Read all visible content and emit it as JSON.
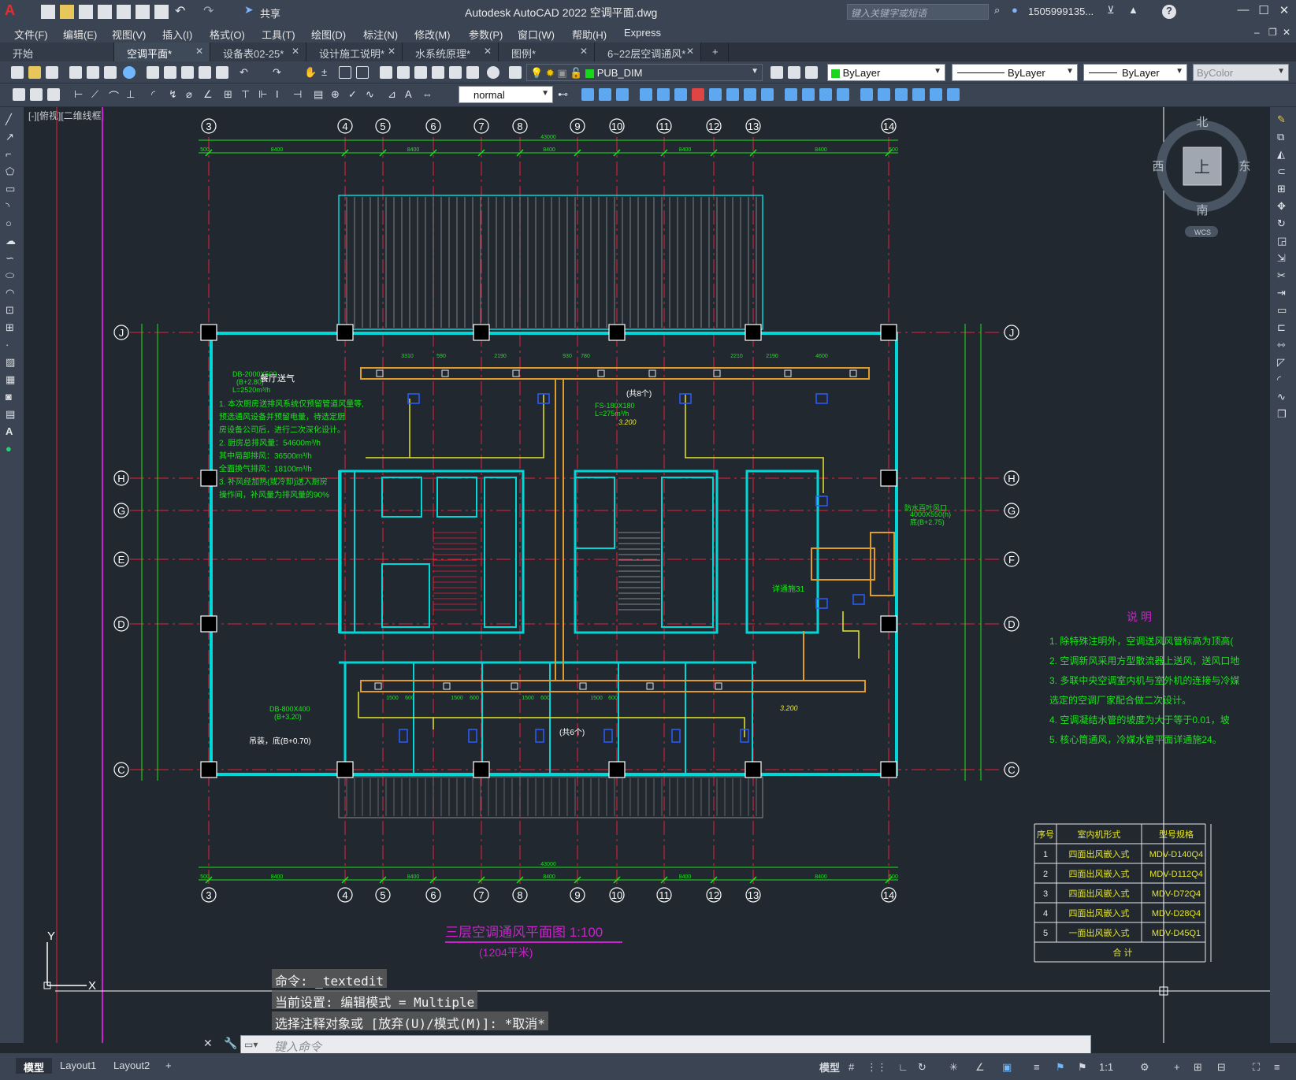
{
  "app": {
    "title": "Autodesk AutoCAD 2022    空调平面.dwg",
    "share": "共享",
    "search_placeholder": "键入关键字或短语",
    "user": "1505999135...",
    "help": "?"
  },
  "menu": [
    "文件(F)",
    "编辑(E)",
    "视图(V)",
    "插入(I)",
    "格式(O)",
    "工具(T)",
    "绘图(D)",
    "标注(N)",
    "修改(M)",
    "参数(P)",
    "窗口(W)",
    "帮助(H)",
    "Express"
  ],
  "file_tabs": [
    {
      "label": "开始",
      "active": false
    },
    {
      "label": "空调平面*",
      "active": true
    },
    {
      "label": "设备表02-25*",
      "active": false
    },
    {
      "label": "设计施工说明*",
      "active": false
    },
    {
      "label": "水系统原理*",
      "active": false
    },
    {
      "label": "图例*",
      "active": false
    },
    {
      "label": "6~22层空调通风*",
      "active": false
    }
  ],
  "ribbon": {
    "layer": "PUB_DIM",
    "color": "ByLayer",
    "linetype": "ByLayer",
    "lineweight": "ByLayer",
    "plotstyle": "ByColor",
    "textstyle": "normal"
  },
  "viewport": {
    "label": "[-][俯视][二维线框]"
  },
  "viewcube": {
    "north": "北",
    "south": "南",
    "east": "东",
    "west": "西",
    "face": "上",
    "wcs": "WCS"
  },
  "drawing": {
    "top_axes": [
      "3",
      "4",
      "5",
      "6",
      "7",
      "8",
      "9",
      "10",
      "11",
      "12",
      "13",
      "14"
    ],
    "left_axes": [
      "J",
      "H",
      "G",
      "E",
      "D",
      "C"
    ],
    "right_axes": [
      "J",
      "H",
      "G",
      "F",
      "D",
      "C"
    ],
    "overall_dim": "43000",
    "bay_dims": [
      "8400",
      "8400",
      "8400",
      "8400",
      "8400"
    ],
    "bay_small": [
      "500",
      "500"
    ],
    "title": "三层空调通风平面图  1:100",
    "subtitle": "(1204平米)",
    "notes_title": "说  明",
    "notes": [
      "1. 除特殊注明外，空调送风风管标高为顶高(",
      "2. 空调新风采用方型散流器上送风，送风口地",
      "3. 多联中央空调室内机与室外机的连接与冷媒",
      "    选定的空调厂家配合做二次设计。",
      "4. 空调凝结水管的坡度为大于等于0.01，坡",
      "5. 核心筒通风，冷媒水管平面详通施24。"
    ],
    "kitchen_notes": [
      "1. 本次厨房送排风系统仅预留管道风量等,",
      "   预选通风设备并预留电量，待选定厨",
      "   房设备公司后，进行二次深化设计。",
      "2. 厨房总排风量：54600m³/h",
      "   其中局部排风：36500m³/h",
      "        全面换气排风：18100m³/h",
      "3. 补风经加热(或冷却)送入厨房",
      "   操作间，补风量为排风量的90%"
    ],
    "labels": {
      "kitchen_exhaust": "餐厅送气",
      "db1": "DB-2000X500",
      "db1_level": "(B+2.80)",
      "db1_flow": "L=2520m³/h",
      "fs1": "FS-180X180",
      "fs1_flow": "L=275m³/h",
      "fs1_count": "(共8个)",
      "elev1": "3.200",
      "rain_louver": "防水百叶风口",
      "rain_size": "4000X550(h)",
      "rain_level": "底(B+2.75)",
      "detail31": "详通施31",
      "fs2_count": "(共6个)",
      "elev2": "3.200",
      "db2": "DB-800X400",
      "db2_level": "(B+3.20)",
      "hang": "吊装，底(B+0.70)",
      "dims_upper": [
        "3310",
        "590",
        "2190",
        "930",
        "780",
        "2210",
        "2190",
        "4600"
      ],
      "dims_lower": [
        "1500",
        "600",
        "1500",
        "600",
        "1500",
        "600",
        "1500",
        "600"
      ]
    },
    "table": {
      "headers": [
        "序号",
        "室内机形式",
        "型号规格"
      ],
      "rows": [
        [
          "1",
          "四面出风嵌入式",
          "MDV-D140Q4"
        ],
        [
          "2",
          "四面出风嵌入式",
          "MDV-D112Q4"
        ],
        [
          "3",
          "四面出风嵌入式",
          "MDV-D72Q4"
        ],
        [
          "4",
          "四面出风嵌入式",
          "MDV-D28Q4"
        ],
        [
          "5",
          "一面出风嵌入式",
          "MDV-D45Q1"
        ]
      ],
      "total": "合    计"
    }
  },
  "command_history": [
    "命令: _textedit",
    "当前设置: 编辑模式 = Multiple",
    "选择注释对象或 [放弃(U)/模式(M)]: *取消*"
  ],
  "command_placeholder": "键入命令",
  "layout_tabs": [
    {
      "label": "模型",
      "active": true
    },
    {
      "label": "Layout1",
      "active": false
    },
    {
      "label": "Layout2",
      "active": false
    }
  ],
  "status": {
    "model": "模型",
    "scale": "1:1"
  },
  "colors": {
    "background": "#212830",
    "wall": "#00d8d8",
    "grid_line": "#e8203a",
    "dimension": "#19e619",
    "duct": "#e09c2a",
    "pipe": "#e6e62a",
    "annotation": "#cc22cc"
  }
}
